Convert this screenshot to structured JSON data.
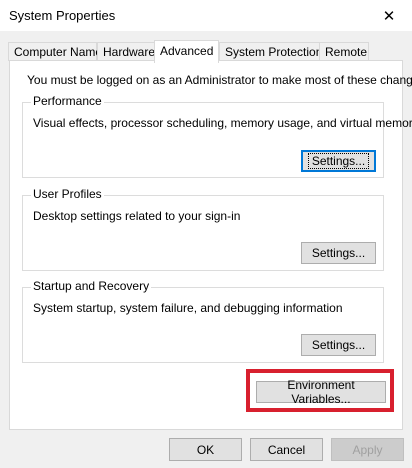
{
  "window": {
    "title": "System Properties",
    "close_glyph": "✕"
  },
  "tabs": [
    {
      "label": "Computer Name",
      "active": false
    },
    {
      "label": "Hardware",
      "active": false
    },
    {
      "label": "Advanced",
      "active": true
    },
    {
      "label": "System Protection",
      "active": false
    },
    {
      "label": "Remote",
      "active": false
    }
  ],
  "admin_note": "You must be logged on as an Administrator to make most of these changes.",
  "performance": {
    "legend": "Performance",
    "description": "Visual effects, processor scheduling, memory usage, and virtual memory",
    "settings_label": "Settings..."
  },
  "user_profiles": {
    "legend": "User Profiles",
    "description": "Desktop settings related to your sign-in",
    "settings_label": "Settings..."
  },
  "startup_recovery": {
    "legend": "Startup and Recovery",
    "description": "System startup, system failure, and debugging information",
    "settings_label": "Settings..."
  },
  "environment_variables_label": "Environment Variables...",
  "footer": {
    "ok_label": "OK",
    "cancel_label": "Cancel",
    "apply_label": "Apply"
  },
  "colors": {
    "highlight": "#d8202e",
    "focus": "#0078d7"
  }
}
